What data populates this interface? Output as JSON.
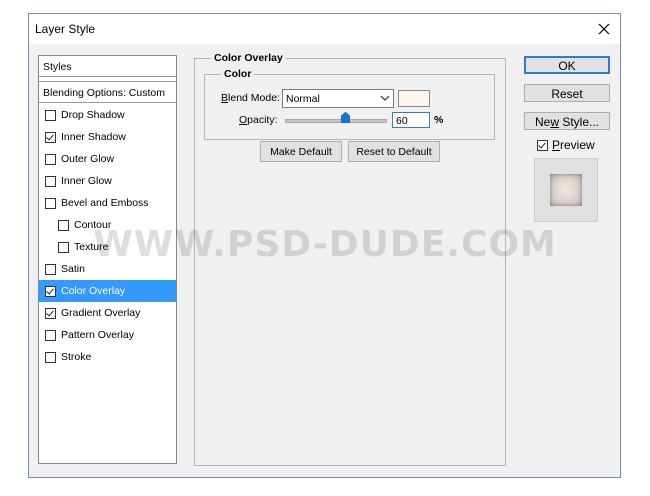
{
  "window": {
    "title": "Layer Style"
  },
  "styles_list": {
    "header": "Styles",
    "blending": "Blending Options: Custom",
    "items": [
      {
        "label": "Drop Shadow",
        "checked": false,
        "indent": false,
        "selected": false
      },
      {
        "label": "Inner Shadow",
        "checked": true,
        "indent": false,
        "selected": false
      },
      {
        "label": "Outer Glow",
        "checked": false,
        "indent": false,
        "selected": false
      },
      {
        "label": "Inner Glow",
        "checked": false,
        "indent": false,
        "selected": false
      },
      {
        "label": "Bevel and Emboss",
        "checked": false,
        "indent": false,
        "selected": false
      },
      {
        "label": "Contour",
        "checked": false,
        "indent": true,
        "selected": false
      },
      {
        "label": "Texture",
        "checked": false,
        "indent": true,
        "selected": false
      },
      {
        "label": "Satin",
        "checked": false,
        "indent": false,
        "selected": false
      },
      {
        "label": "Color Overlay",
        "checked": true,
        "indent": false,
        "selected": true
      },
      {
        "label": "Gradient Overlay",
        "checked": true,
        "indent": false,
        "selected": false
      },
      {
        "label": "Pattern Overlay",
        "checked": false,
        "indent": false,
        "selected": false
      },
      {
        "label": "Stroke",
        "checked": false,
        "indent": false,
        "selected": false
      }
    ]
  },
  "panel": {
    "title": "Color Overlay",
    "group_title": "Color",
    "blend_mode_label_u": "B",
    "blend_mode_label_rest": "lend Mode:",
    "blend_mode_value": "Normal",
    "overlay_color": "#fdf4ec",
    "opacity_label_u": "O",
    "opacity_label_rest": "pacity:",
    "opacity_value": "60",
    "opacity_unit": "%",
    "opacity_level": 0.6,
    "make_default": "Make Default",
    "reset_default": "Reset to Default"
  },
  "actions": {
    "ok": "OK",
    "reset": "Reset",
    "new_style_pre": "Ne",
    "new_style_u": "w",
    "new_style_post": " Style...",
    "preview_u": "P",
    "preview_rest": "review",
    "preview_checked": true
  },
  "watermark": "WWW.PSD-DUDE.COM",
  "colors": {
    "accent": "#3399ff",
    "default_button_border": "#2f7bd1"
  }
}
